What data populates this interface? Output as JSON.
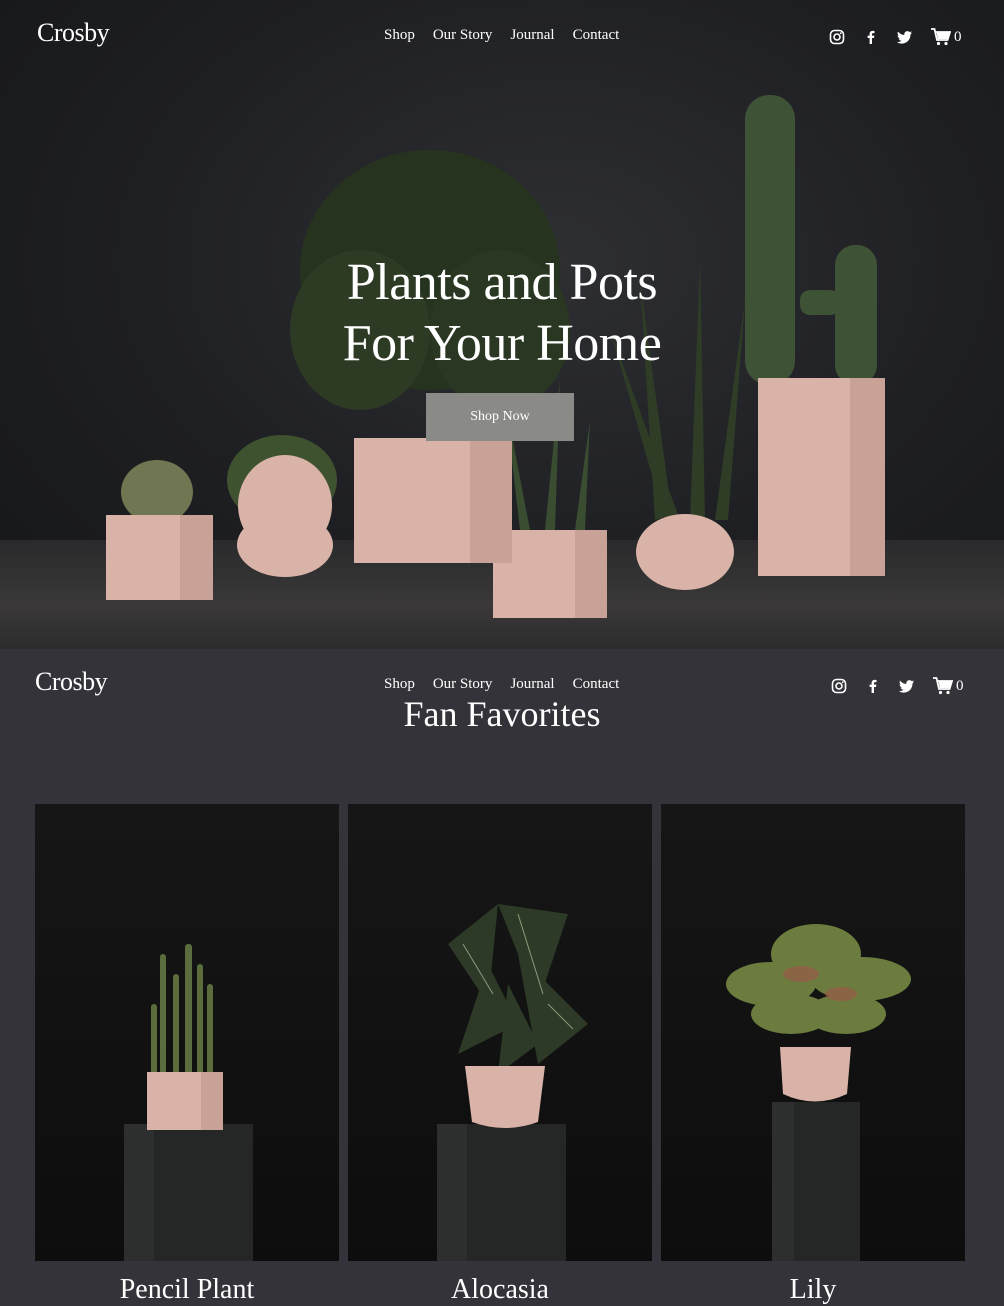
{
  "brand": "Crosby",
  "nav": [
    "Shop",
    "Our Story",
    "Journal",
    "Contact"
  ],
  "social_icons": [
    "instagram-icon",
    "facebook-icon",
    "twitter-icon"
  ],
  "cart": {
    "icon": "cart-icon",
    "count": "0"
  },
  "hero": {
    "headline_line1": "Plants and Pots",
    "headline_line2": "For Your Home",
    "cta_label": "Shop Now"
  },
  "favorites": {
    "title": "Fan Favorites",
    "products": [
      {
        "name": "Pencil Plant"
      },
      {
        "name": "Alocasia"
      },
      {
        "name": "Lily"
      }
    ]
  },
  "colors": {
    "background": "#34333a",
    "button": "#8a8a87",
    "pot_pink": "#d9b3a8"
  }
}
